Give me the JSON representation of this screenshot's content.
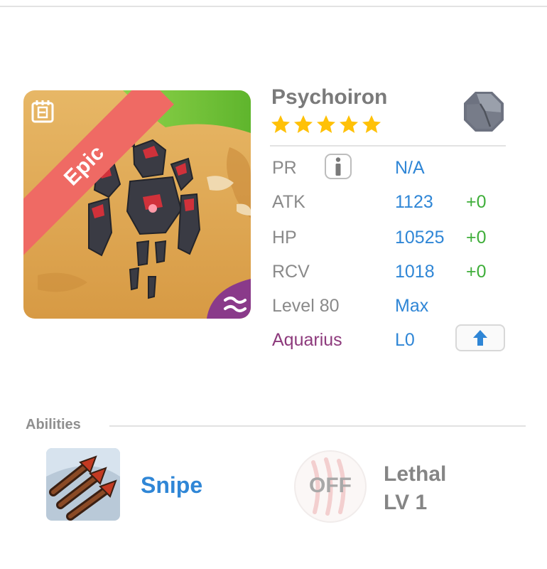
{
  "monster": {
    "name": "Psychoiron",
    "rarity": "Epic",
    "stars": 5,
    "star_color": "#ffc107",
    "type_icon": "rock-octagon-icon",
    "element_icon": "water-waves-icon"
  },
  "stats": {
    "pr": {
      "label": "PR",
      "value": "N/A"
    },
    "atk": {
      "label": "ATK",
      "value": "1123",
      "bonus": "+0"
    },
    "hp": {
      "label": "HP",
      "value": "10525",
      "bonus": "+0"
    },
    "rcv": {
      "label": "RCV",
      "value": "1018",
      "bonus": "+0"
    },
    "level": {
      "label": "Level 80",
      "value": "Max"
    },
    "constellation": {
      "label": "Aquarius",
      "value": "L0"
    }
  },
  "abilities": {
    "title": "Abilities",
    "active": {
      "name": "Snipe",
      "icon": "triple-arrow-icon"
    },
    "passive": {
      "status": "OFF",
      "name": "Lethal",
      "level": "LV 1",
      "icon": "claw-marks-icon"
    }
  },
  "colors": {
    "accent_blue": "#2f86d6",
    "bonus_green": "#3fae3a",
    "aquarius_purple": "#8d3a7c",
    "epic_ribbon": "#ef6a64"
  }
}
